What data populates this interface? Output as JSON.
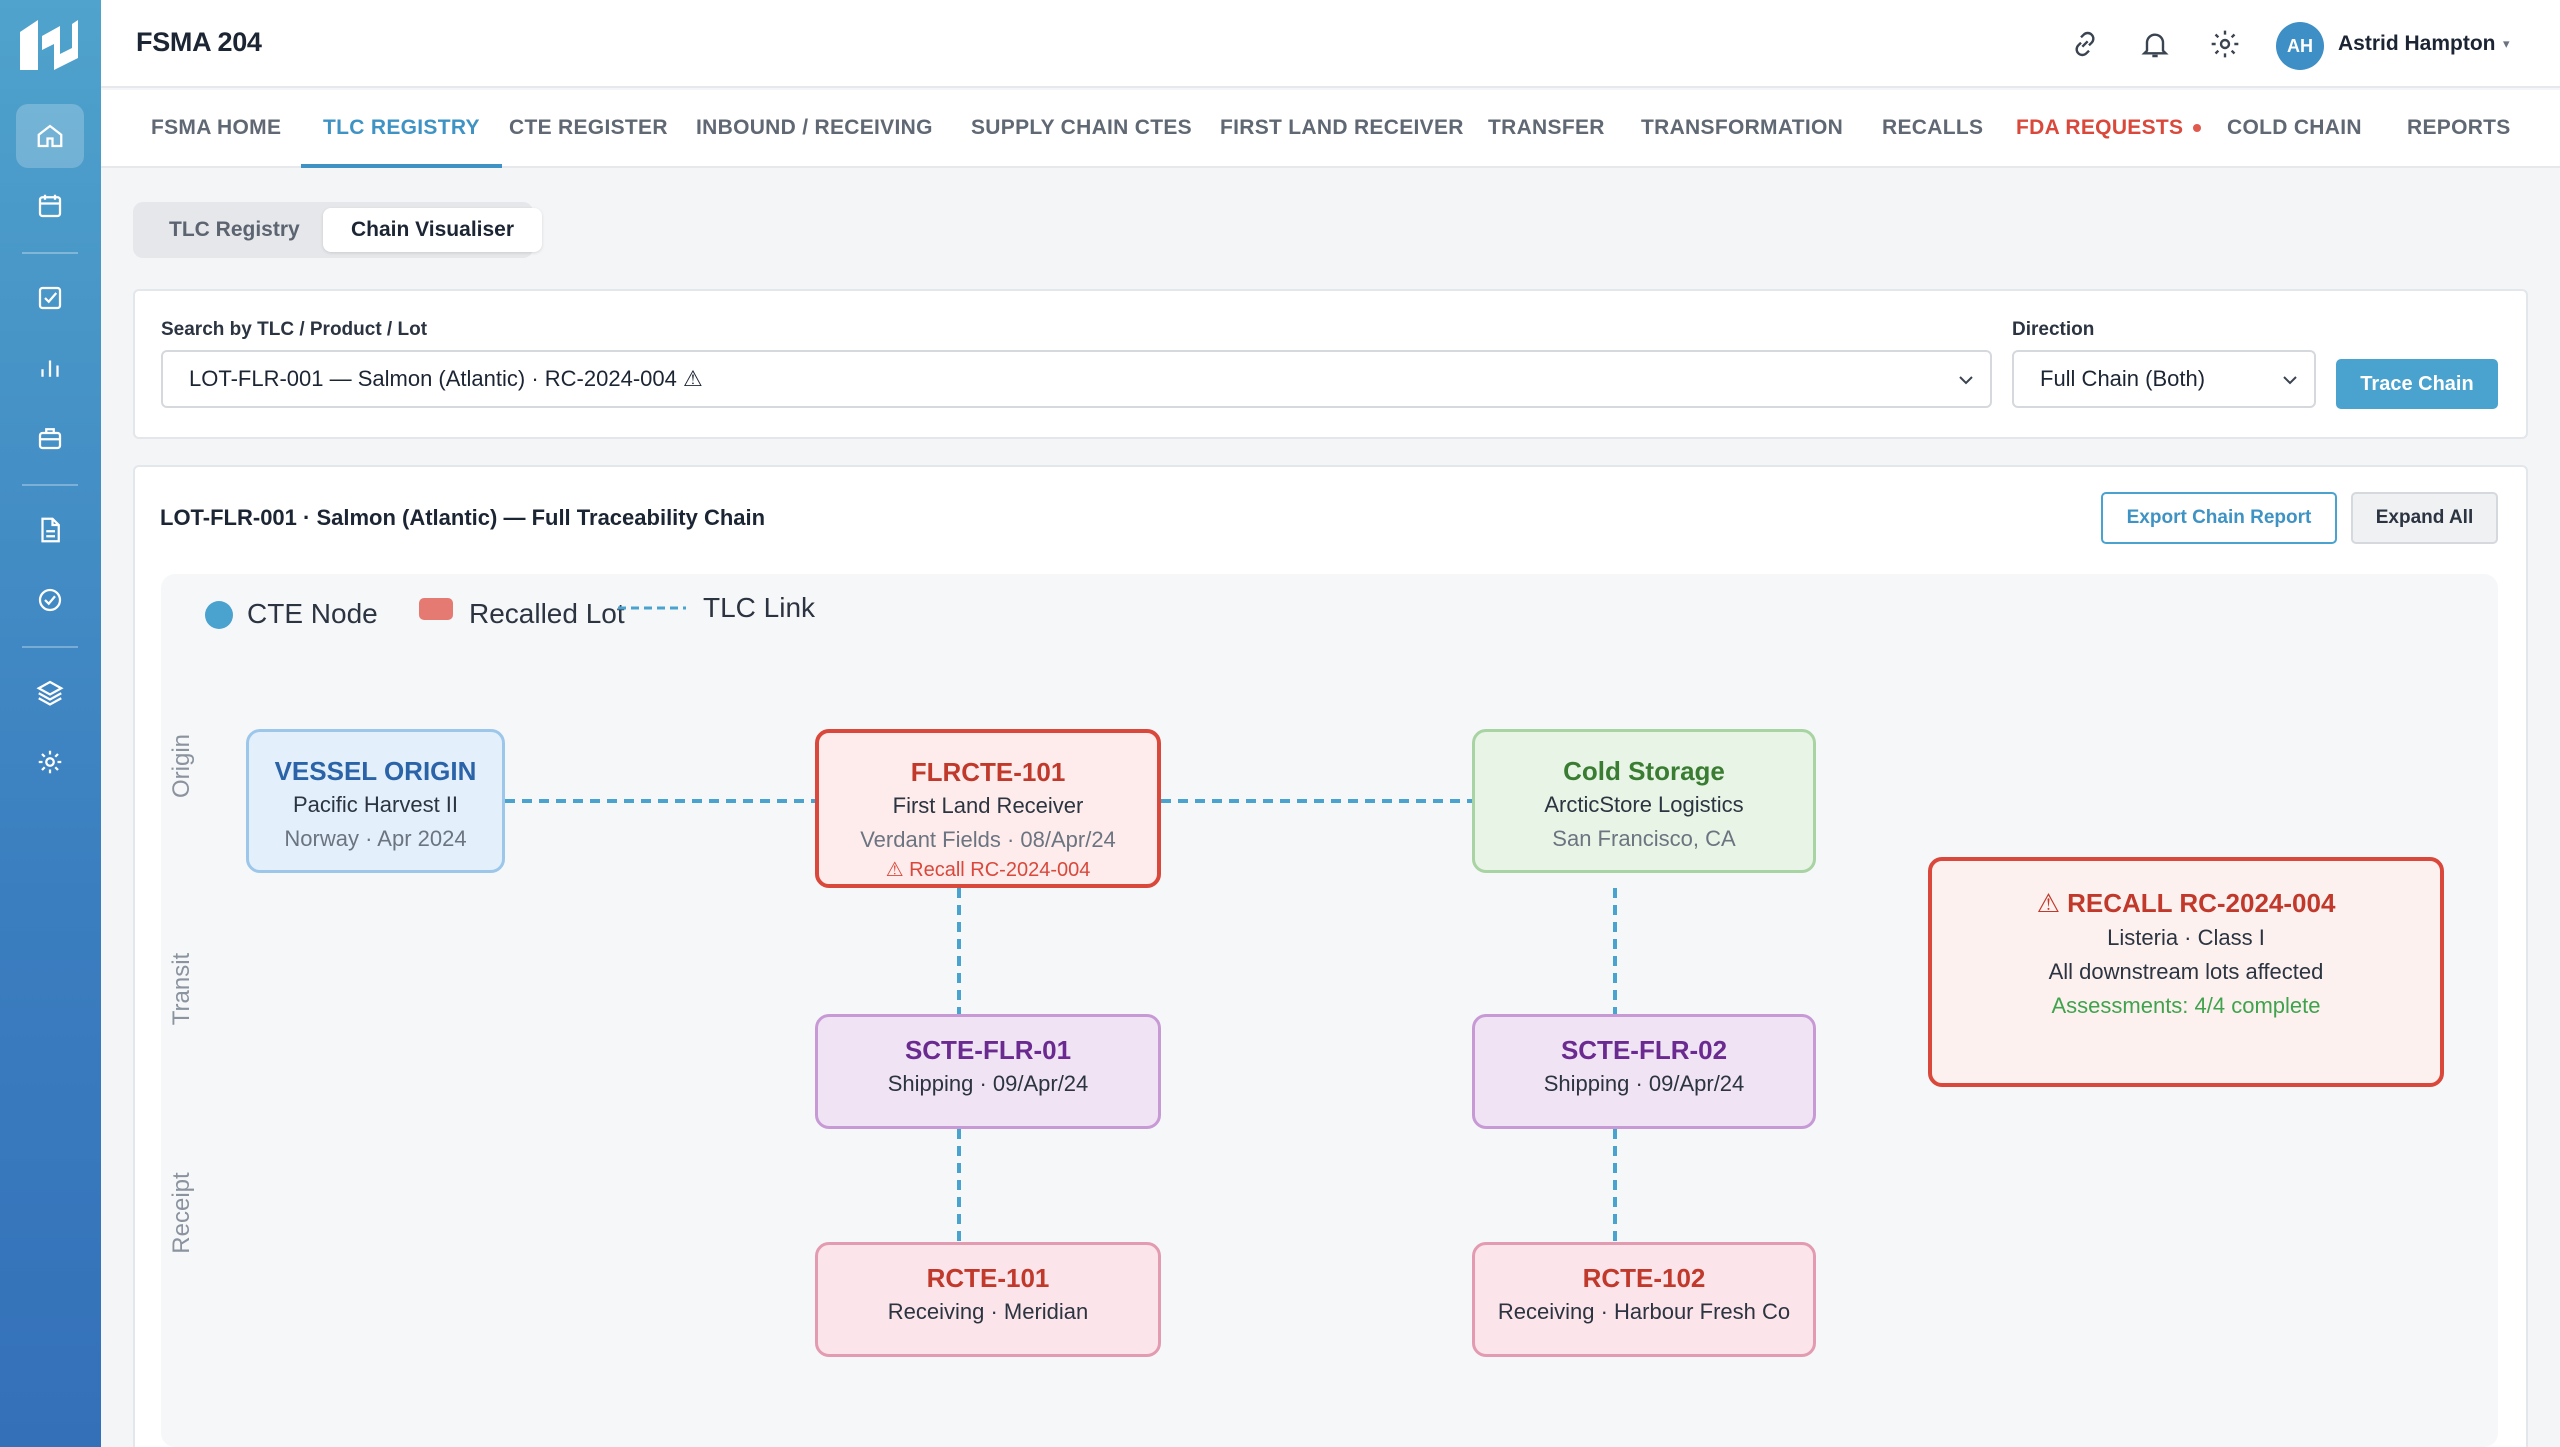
{
  "app": {
    "title": "FSMA 204"
  },
  "user": {
    "initials": "AH",
    "name": "Astrid Hampton",
    "caret": "▾"
  },
  "nav_tabs": [
    {
      "label": "FSMA HOME"
    },
    {
      "label": "TLC REGISTRY"
    },
    {
      "label": "CTE REGISTER"
    },
    {
      "label": "INBOUND / RECEIVING"
    },
    {
      "label": "SUPPLY CHAIN CTES"
    },
    {
      "label": "FIRST LAND RECEIVER"
    },
    {
      "label": "TRANSFER"
    },
    {
      "label": "TRANSFORMATION"
    },
    {
      "label": "RECALLS"
    },
    {
      "label": "FDA REQUESTS"
    },
    {
      "label": "COLD CHAIN"
    },
    {
      "label": "REPORTS"
    }
  ],
  "active_tab": "TLC REGISTRY",
  "sub_tabs": [
    {
      "label": "TLC Registry"
    },
    {
      "label": "Chain Visualiser"
    }
  ],
  "search": {
    "label": "Search by TLC / Product / Lot",
    "value": "LOT-FLR-001 — Salmon (Atlantic) · RC-2024-004 ⚠",
    "direction_label": "Direction",
    "direction_value": "Full Chain (Both)",
    "trace_button": "Trace Chain"
  },
  "chain": {
    "title": "LOT-FLR-001 · Salmon (Atlantic) — Full Traceability Chain",
    "export_button": "Export Chain Report",
    "expand_button": "Expand All",
    "legend": {
      "cte_node": "CTE Node",
      "recalled_lot": "Recalled Lot",
      "tlc_link": "TLC Link"
    },
    "lanes": {
      "origin": "Origin",
      "transit": "Transit",
      "receipt": "Receipt"
    },
    "nodes": {
      "vessel": {
        "title": "VESSEL ORIGIN",
        "line1": "Pacific Harvest II",
        "line2": "Norway · Apr 2024"
      },
      "flrcte": {
        "title": "FLRCTE-101",
        "line1": "First Land Receiver",
        "line2": "Verdant Fields · 08/Apr/24",
        "alert": "⚠ Recall RC-2024-004"
      },
      "cold": {
        "title": "Cold Storage",
        "line1": "ArcticStore Logistics",
        "line2": "San Francisco, CA"
      },
      "scte1": {
        "title": "SCTE-FLR-01",
        "line1": "Shipping · 09/Apr/24"
      },
      "scte2": {
        "title": "SCTE-FLR-02",
        "line1": "Shipping · 09/Apr/24"
      },
      "rcte1": {
        "title": "RCTE-101",
        "line1": "Receiving · Meridian"
      },
      "rcte2": {
        "title": "RCTE-102",
        "line1": "Receiving · Harbour Fresh Co"
      }
    },
    "recall": {
      "title": "⚠ RECALL RC-2024-004",
      "line1": "Listeria · Class I",
      "line2": "All downstream lots affected",
      "status": "Assessments: 4/4 complete"
    }
  },
  "colors": {
    "accent": "#3e93c4",
    "recall": "#d9483b",
    "link": "#4aa2cf",
    "ok": "#3fa34d"
  }
}
